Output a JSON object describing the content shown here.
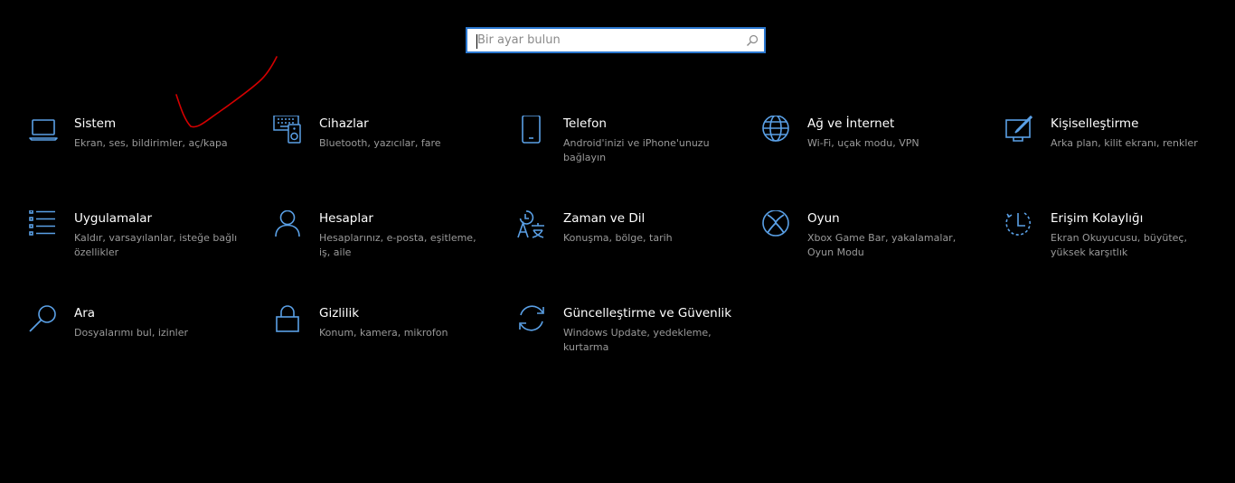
{
  "search": {
    "placeholder": "Bir ayar bulun"
  },
  "accent_color": "#5aa0e6",
  "tiles": [
    {
      "title": "Sistem",
      "desc": "Ekran, ses, bildirimler, aç/kapa",
      "icon": "laptop-icon"
    },
    {
      "title": "Cihazlar",
      "desc": "Bluetooth, yazıcılar, fare",
      "icon": "devices-icon"
    },
    {
      "title": "Telefon",
      "desc": "Android'inizi ve iPhone'unuzu bağlayın",
      "icon": "phone-icon"
    },
    {
      "title": "Ağ ve İnternet",
      "desc": "Wi-Fi, uçak modu, VPN",
      "icon": "globe-icon"
    },
    {
      "title": "Kişiselleştirme",
      "desc": "Arka plan, kilit ekranı, renkler",
      "icon": "personalization-icon"
    },
    {
      "title": "Uygulamalar",
      "desc": "Kaldır, varsayılanlar, isteğe bağlı özellikler",
      "icon": "apps-list-icon"
    },
    {
      "title": "Hesaplar",
      "desc": "Hesaplarınız, e-posta, eşitleme, iş, aile",
      "icon": "person-icon"
    },
    {
      "title": "Zaman ve Dil",
      "desc": "Konuşma, bölge, tarih",
      "icon": "time-language-icon"
    },
    {
      "title": "Oyun",
      "desc": "Xbox Game Bar, yakalamalar, Oyun Modu",
      "icon": "xbox-icon"
    },
    {
      "title": "Erişim Kolaylığı",
      "desc": "Ekran Okuyucusu, büyüteç, yüksek karşıtlık",
      "icon": "ease-of-access-icon"
    },
    {
      "title": "Ara",
      "desc": "Dosyalarımı bul, izinler",
      "icon": "search-icon"
    },
    {
      "title": "Gizlilik",
      "desc": "Konum, kamera, mikrofon",
      "icon": "lock-icon"
    },
    {
      "title": "Güncelleştirme ve Güvenlik",
      "desc": "Windows Update, yedekleme, kurtarma",
      "icon": "sync-icon"
    }
  ]
}
